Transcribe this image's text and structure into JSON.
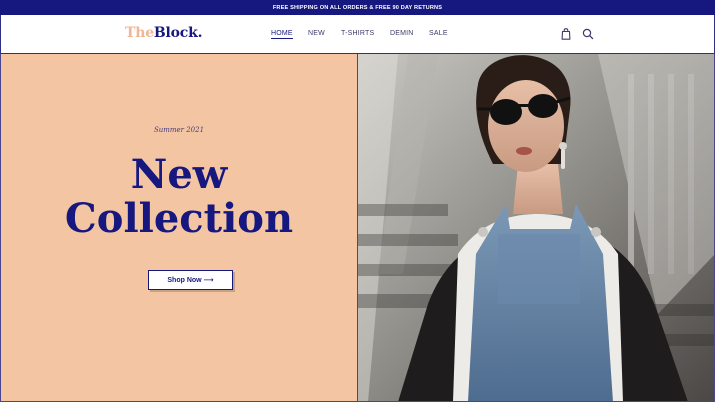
{
  "promo": {
    "text": "FREE SHIPPING ON ALL ORDERS & FREE 90 DAY RETURNS"
  },
  "brand": {
    "name_part1": "The",
    "name_part2": "Block."
  },
  "nav": {
    "items": [
      {
        "label": "HOME",
        "active": true
      },
      {
        "label": "NEW",
        "active": false
      },
      {
        "label": "T-SHIRTS",
        "active": false
      },
      {
        "label": "DEMIN",
        "active": false
      },
      {
        "label": "SALE",
        "active": false
      }
    ]
  },
  "icons": {
    "cart": "shopping-bag-icon",
    "search": "search-icon"
  },
  "hero": {
    "eyebrow": "Summer 2021",
    "headline_line1": "New",
    "headline_line2": "Collection",
    "cta_label": "Shop Now ⟶",
    "photo": "fashion-model-photo"
  },
  "colors": {
    "primary": "#16177f",
    "hero_background": "#f3c5a3",
    "brand_accent": "#f0b795"
  }
}
